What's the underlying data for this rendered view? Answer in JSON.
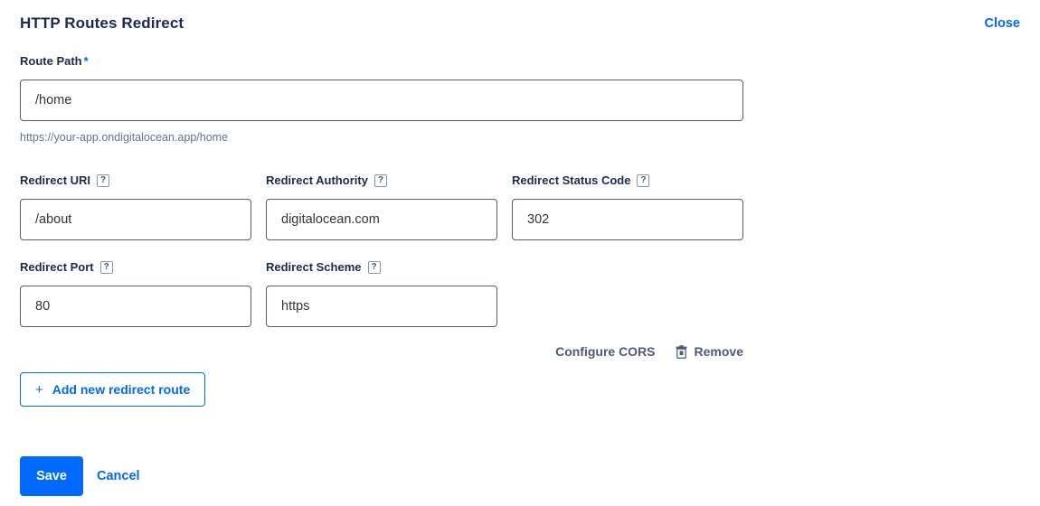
{
  "header": {
    "title": "HTTP Routes Redirect",
    "close_label": "Close"
  },
  "route_path": {
    "label": "Route Path",
    "required_marker": "*",
    "value": "/home",
    "helper_text": "https://your-app.ondigitalocean.app/home"
  },
  "fields": {
    "redirect_uri": {
      "label": "Redirect URI",
      "help_icon": "help-badge",
      "help_glyph": "?",
      "value": "/about"
    },
    "redirect_authority": {
      "label": "Redirect Authority",
      "help_icon": "help-badge",
      "help_glyph": "?",
      "value": "digitalocean.com"
    },
    "redirect_status_code": {
      "label": "Redirect Status Code",
      "help_icon": "help-badge",
      "help_glyph": "?",
      "value": "302"
    },
    "redirect_port": {
      "label": "Redirect Port",
      "help_icon": "help-badge",
      "help_glyph": "?",
      "value": "80"
    },
    "redirect_scheme": {
      "label": "Redirect Scheme",
      "help_icon": "help-badge",
      "help_glyph": "?",
      "value": "https"
    }
  },
  "row_actions": {
    "configure_cors_label": "Configure CORS",
    "remove_label": "Remove",
    "remove_icon": "trash-icon"
  },
  "add_route": {
    "label": "Add new redirect route",
    "icon": "plus-icon",
    "icon_glyph": "+"
  },
  "footer": {
    "save_label": "Save",
    "cancel_label": "Cancel"
  },
  "colors": {
    "brand_blue": "#0069ff",
    "title_navy": "#1b2a4e",
    "input_border": "#4e5f77",
    "helper_gray": "#68738a",
    "action_slate": "#4c5c74"
  }
}
